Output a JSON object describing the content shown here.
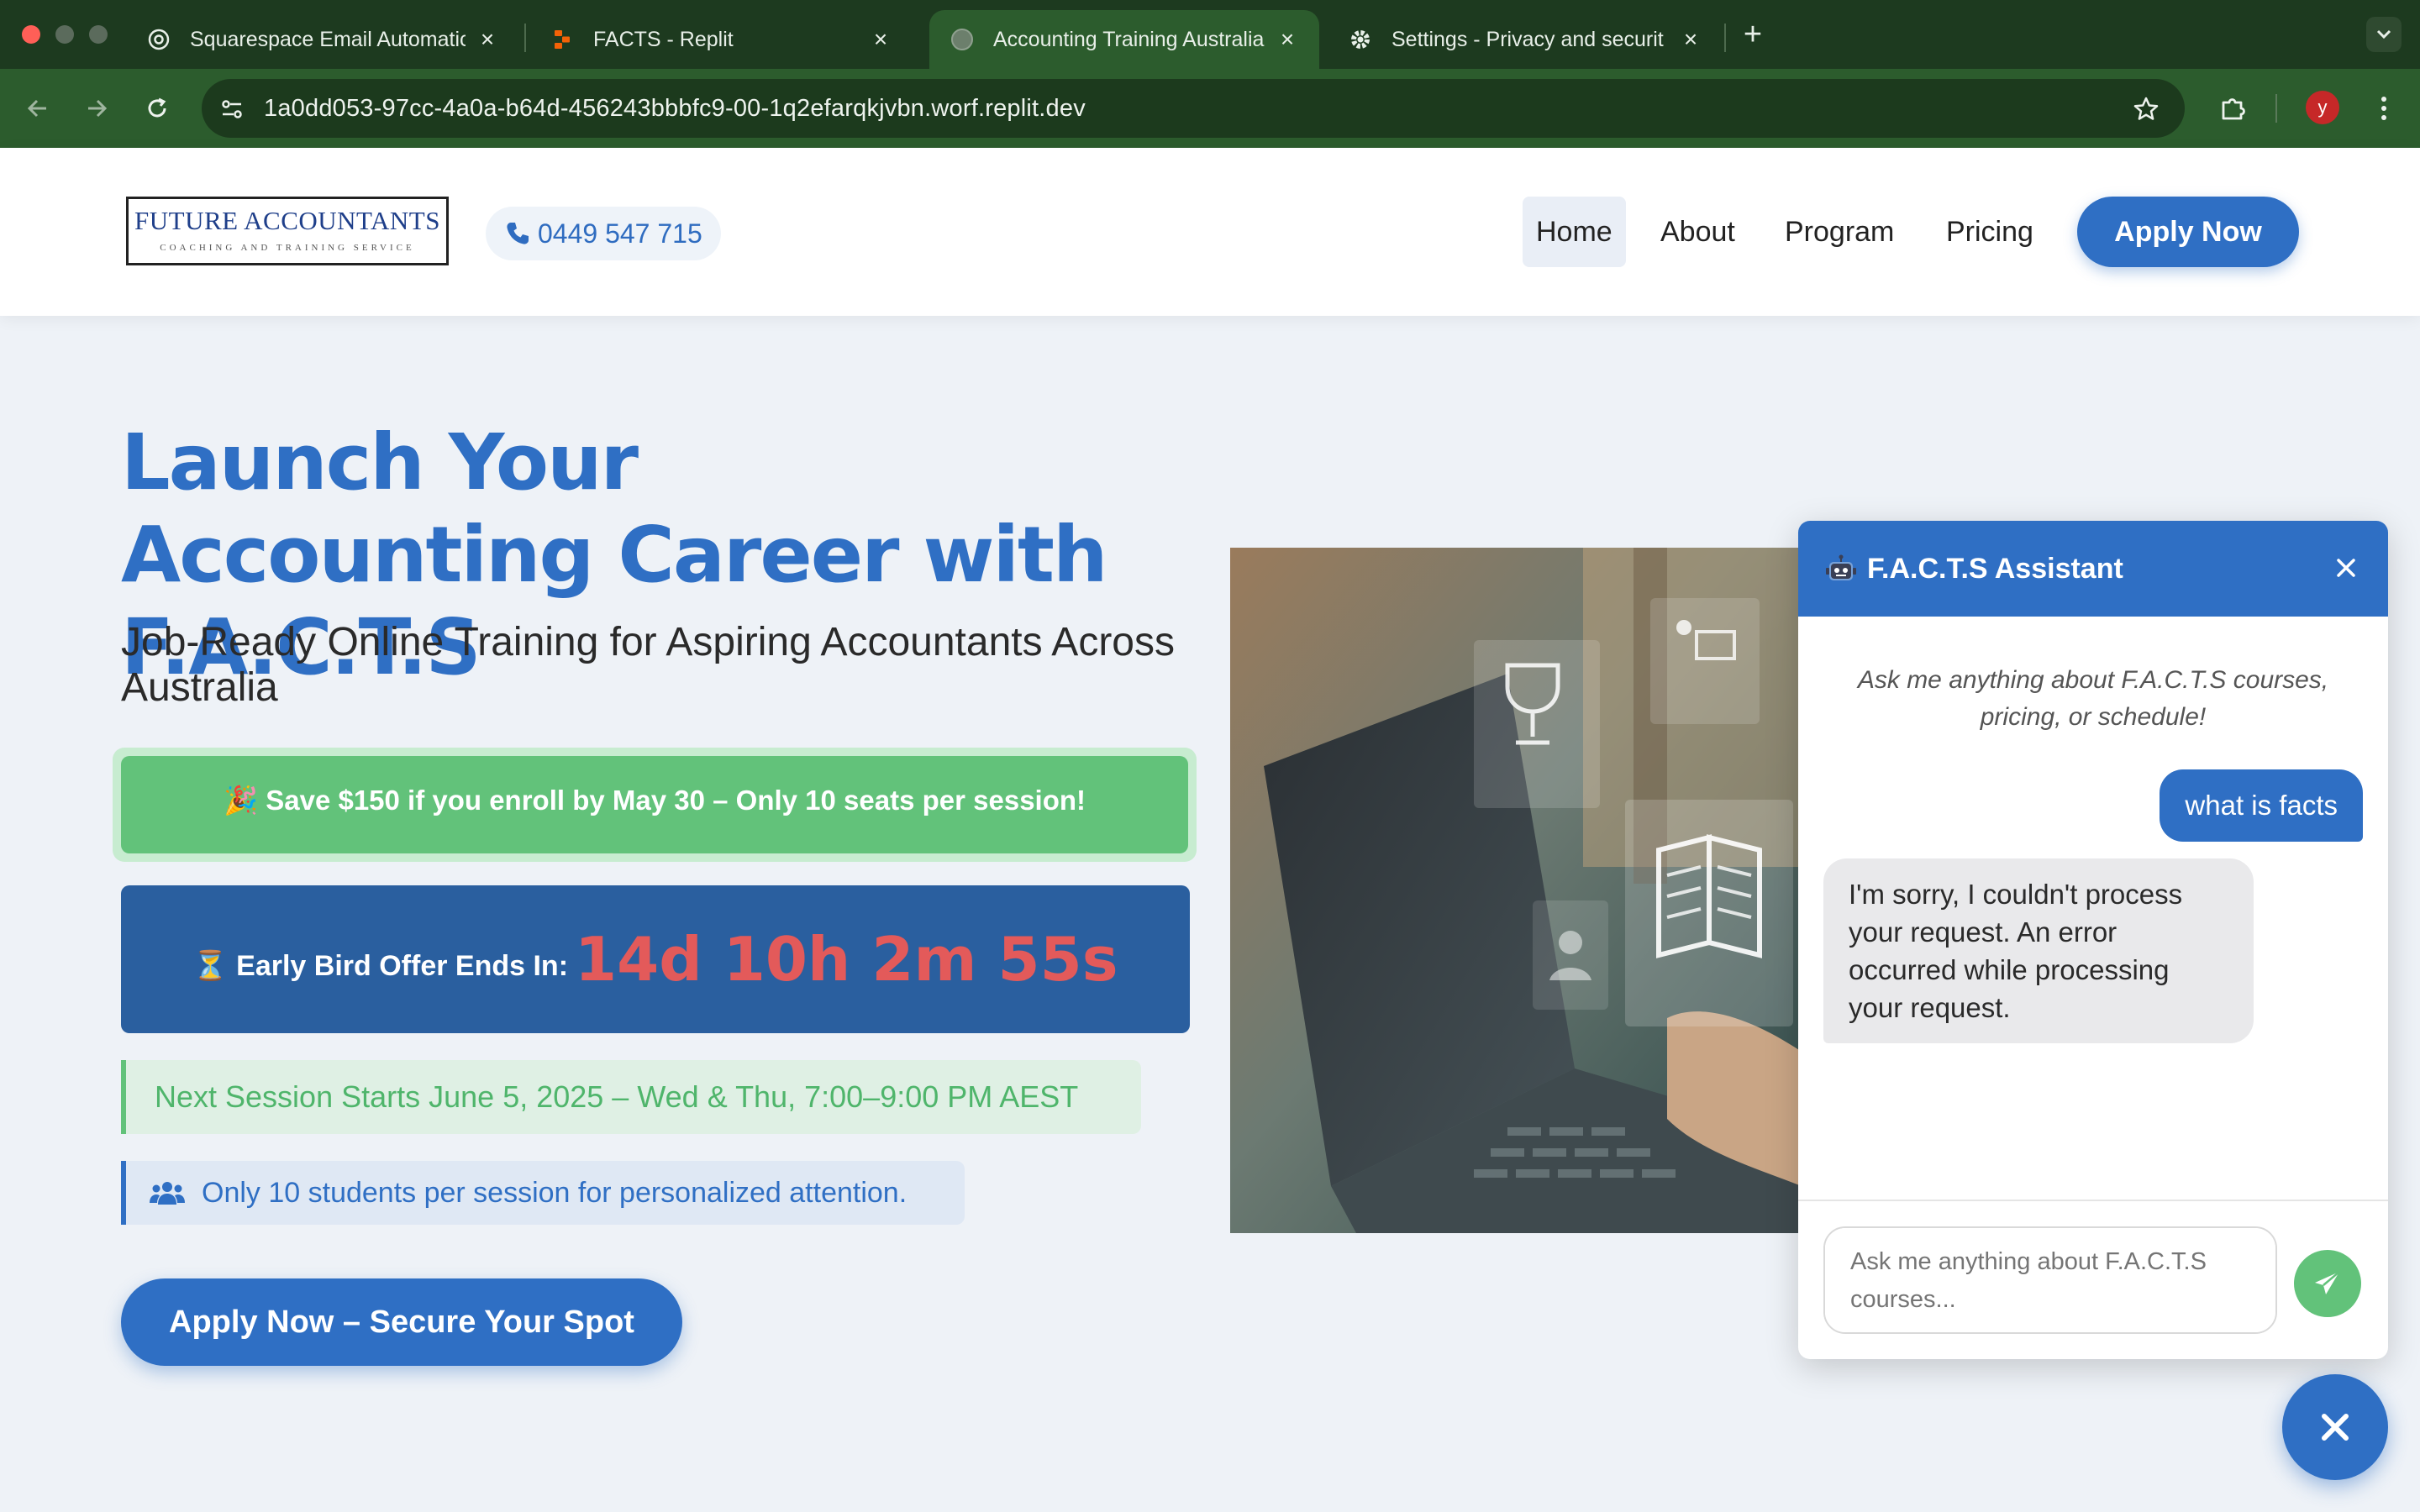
{
  "browser": {
    "tabs": [
      {
        "title": "Squarespace Email Automatic",
        "icon": "openai-icon"
      },
      {
        "title": "FACTS - Replit",
        "icon": "replit-icon"
      },
      {
        "title": "Accounting Training Australia",
        "icon": "globe-icon"
      },
      {
        "title": "Settings - Privacy and securit",
        "icon": "gear-icon"
      }
    ],
    "active_tab": 2,
    "url": "1a0dd053-97cc-4a0a-b64d-456243bbbfc9-00-1q2efarqkjvbn.worf.replit.dev",
    "profile_initial": "y",
    "theme_color": "#2c5c2d"
  },
  "site": {
    "logo_main": "FUTURE ACCOUNTANTS",
    "logo_sub": "COACHING AND TRAINING SERVICE",
    "phone": "0449 547 715",
    "nav": [
      "Home",
      "About",
      "Program",
      "Pricing"
    ],
    "nav_active": "Home",
    "apply_label": "Apply Now",
    "accent": "#2f6fc4",
    "success": "#62c27a"
  },
  "hero": {
    "title": "Launch Your Accounting Career with F.A.C.T.S",
    "subtitle": "Job-Ready Online Training for Aspiring Accountants Across Australia",
    "promo": "🎉 Save $150 if you enroll by May 30 – Only 10 seats per session!",
    "countdown_label": "⏳ Early Bird Offer Ends In:",
    "countdown_time": "14d 10h 2m 55s",
    "session": "Next Session Starts June 5, 2025 – Wed & Thu, 7:00–9:00 PM AEST",
    "limit": "Only 10 students per session for personalized attention.",
    "cta": "Apply Now – Secure Your Spot"
  },
  "chat": {
    "title": "F.A.C.T.S Assistant",
    "intro": "Ask me anything about F.A.C.T.S courses, pricing, or schedule!",
    "messages": [
      {
        "from": "user",
        "text": "what is facts"
      },
      {
        "from": "bot",
        "text": "I'm sorry, I couldn't process your request. An error occurred while processing your request."
      }
    ],
    "input_placeholder": "Ask me anything about F.A.C.T.S courses..."
  }
}
